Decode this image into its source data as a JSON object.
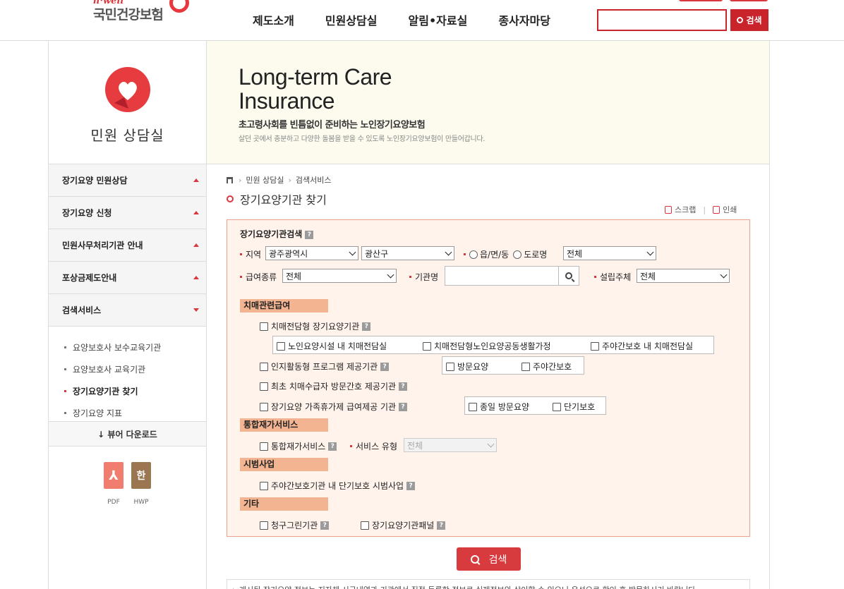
{
  "brand": {
    "en": "h·well",
    "name": "국민건강보험"
  },
  "nav": [
    "제도소개",
    "민원상담실",
    "알림•자료실",
    "종사자마당"
  ],
  "top_search": {
    "button": "검색",
    "placeholder": ""
  },
  "sidebar": {
    "title": "민원 상담실",
    "menu": [
      {
        "label": "장기요양 민원상담",
        "state": "collapsed"
      },
      {
        "label": "장기요양 신청",
        "state": "collapsed"
      },
      {
        "label": "민원사무처리기관 안내",
        "state": "collapsed"
      },
      {
        "label": "포상금제도안내",
        "state": "collapsed"
      },
      {
        "label": "검색서비스",
        "state": "expanded"
      }
    ],
    "submenu": [
      {
        "label": "요양보호사 보수교육기관",
        "active": false
      },
      {
        "label": "요양보호사 교육기관",
        "active": false
      },
      {
        "label": "장기요양기관 찾기",
        "active": true
      },
      {
        "label": "장기요양 지표",
        "active": false
      }
    ],
    "viewer_download": "↓ 뷰어 다운로드",
    "files": [
      {
        "glyph": "⅄",
        "label": "PDF"
      },
      {
        "glyph": "한",
        "label": "HWP"
      }
    ]
  },
  "banner": {
    "title_line1": "Long-term Care",
    "title_line2": "Insurance",
    "subtitle": "초고령사회를 빈틈없이 준비하는 노인장기요양보험",
    "description": "살던 곳에서 충분하고 다양한 돌봄을 받을 수 있도록 노인장기요양보험이 만들어갑니다."
  },
  "breadcrumb": [
    "민원 상담실",
    "검색서비스"
  ],
  "page_title": "장기요양기관 찾기",
  "util": {
    "scrap": "스크랩",
    "print": "인쇄"
  },
  "search_form": {
    "heading": "장기요양기관검색",
    "region_label": "지역",
    "region_city": "광주광역시",
    "region_district": "광산구",
    "radio_town": "읍/면/동",
    "radio_road": "도로명",
    "town_select": "전체",
    "benefit_label": "급여종류",
    "benefit_select": "전체",
    "org_name_label": "기관명",
    "org_name_value": "",
    "founder_label": "설립주체",
    "founder_select": "전체",
    "categories": {
      "dementia": "치매관련급여",
      "integrated": "통합재가서비스",
      "pilot": "시범사업",
      "other": "기타"
    },
    "checks": {
      "dementia_type": "치매전담형 장기요양기관",
      "dementia_facility": "노인요양시설 내 치매전담실",
      "dementia_group_home": "치매전담형노인요양공동생활가정",
      "day_night_dementia": "주야간보호 내 치매전담실",
      "cognitive_program": "인지활동형 프로그램 제공기관",
      "home_visit": "방문요양",
      "day_night_care": "주야간보호",
      "first_dementia_nursing": "최초 치매수급자 방문간호 제공기관",
      "family_respite": "장기요양 가족휴가제 급여제공 기관",
      "all_day_visit": "종일 방문요양",
      "short_term_care": "단기보호",
      "integrated_service": "통합재가서비스",
      "service_type_label": "서비스 유형",
      "service_type_select": "전체",
      "short_term_pilot": "주야간보호기관 내 단기보호 시범사업",
      "clean_billing": "청구그린기관",
      "care_panel": "장기요양기관패널"
    }
  },
  "search_button": "검색",
  "notice": "▸ 게시된 장기요양 정보는 지자체 시군내역과 기관에서 직접 등록한 정보로 실제정보와 상이할 수 있으니 유선으로 확인 후 방문하시기 바랍니다.",
  "colors": {
    "accent": "#d9363e",
    "form_bg": "#fff3ec",
    "category_bg": "#f3b491",
    "banner_bg": "#fdfaee"
  }
}
